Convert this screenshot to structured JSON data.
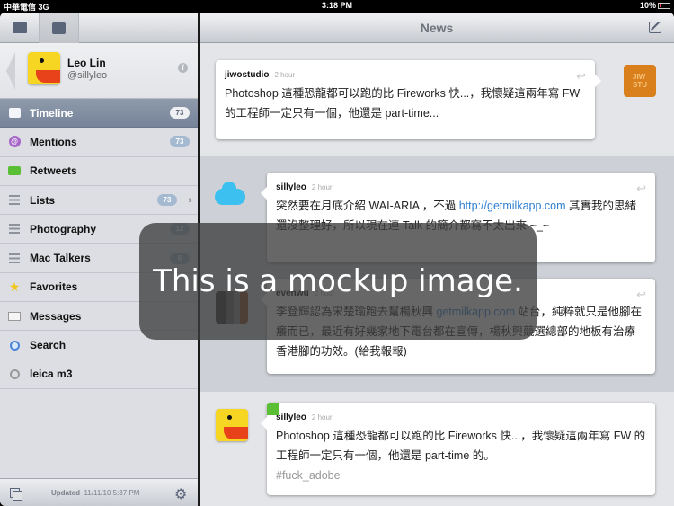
{
  "statusbar": {
    "carrier": "中華電信",
    "network": "3G",
    "time": "3:18 PM",
    "battery": "10%"
  },
  "sidebar": {
    "tabs": [
      {
        "name": "stack-icon"
      },
      {
        "name": "note-icon"
      }
    ],
    "profile": {
      "name": "Leo Lin",
      "handle": "@sillyleo"
    },
    "items": [
      {
        "label": "Timeline",
        "icon": "timeline-icon",
        "badge": "73",
        "active": true
      },
      {
        "label": "Mentions",
        "icon": "mention-icon",
        "badge": "73"
      },
      {
        "label": "Retweets",
        "icon": "retweet-icon",
        "badge": ""
      },
      {
        "label": "Lists",
        "icon": "list-icon",
        "badge": "73",
        "chevron": true
      },
      {
        "label": "Photography",
        "icon": "list-icon",
        "badge": "12"
      },
      {
        "label": "Mac Talkers",
        "icon": "list-icon",
        "badge": "6"
      },
      {
        "label": "Favorites",
        "icon": "star-icon",
        "badge": ""
      },
      {
        "label": "Messages",
        "icon": "mail-icon",
        "badge": ""
      },
      {
        "label": "Search",
        "icon": "search-icon",
        "badge": ""
      },
      {
        "label": "leica m3",
        "icon": "search-icon",
        "badge": ""
      }
    ],
    "footer": {
      "updated_label": "Updated",
      "updated_value": "11/11/10  5:37 PM"
    }
  },
  "main": {
    "title": "News",
    "tweets": [
      {
        "author": "jiwostudio",
        "ago": "2 hour",
        "text": "Photoshop 這種恐龍都可以跑的比 Fireworks 快...，我懷疑這兩年寫 FW 的工程師一定只有一個，他還是 part-time..."
      },
      {
        "author": "sillyleo",
        "ago": "2 hour",
        "text_before": "突然要在月底介紹 WAI-ARIA ，不過 ",
        "link": "http://getmilkapp.com",
        "text_after": " 其實我的思緒還沒整理好，所以現在連 Talk 的簡介都寫不太出來 ~_~"
      },
      {
        "author": "evenwu",
        "ago": "2 hour",
        "text_before": "李登輝認為宋楚瑜跑去幫楊秋興 ",
        "link": "getmilkapp.com",
        "text_after": " 站台，純粹就只是他腳在癢而已，最近有好幾家地下電台都在宣傳，楊秋興競選總部的地板有治療香港腳的功效。(給我報報)"
      },
      {
        "author": "sillyleo",
        "ago": "2 hour",
        "text": "Photoshop 這種恐龍都可以跑的比 Fireworks 快...，我懷疑這兩年寫 FW 的工程師一定只有一個，他還是 part-time 的。",
        "hashtag": "#fuck_adobe"
      }
    ],
    "avatar_jiwo_text": "JIW STU"
  },
  "overlay": {
    "text": "This is a mockup image."
  }
}
